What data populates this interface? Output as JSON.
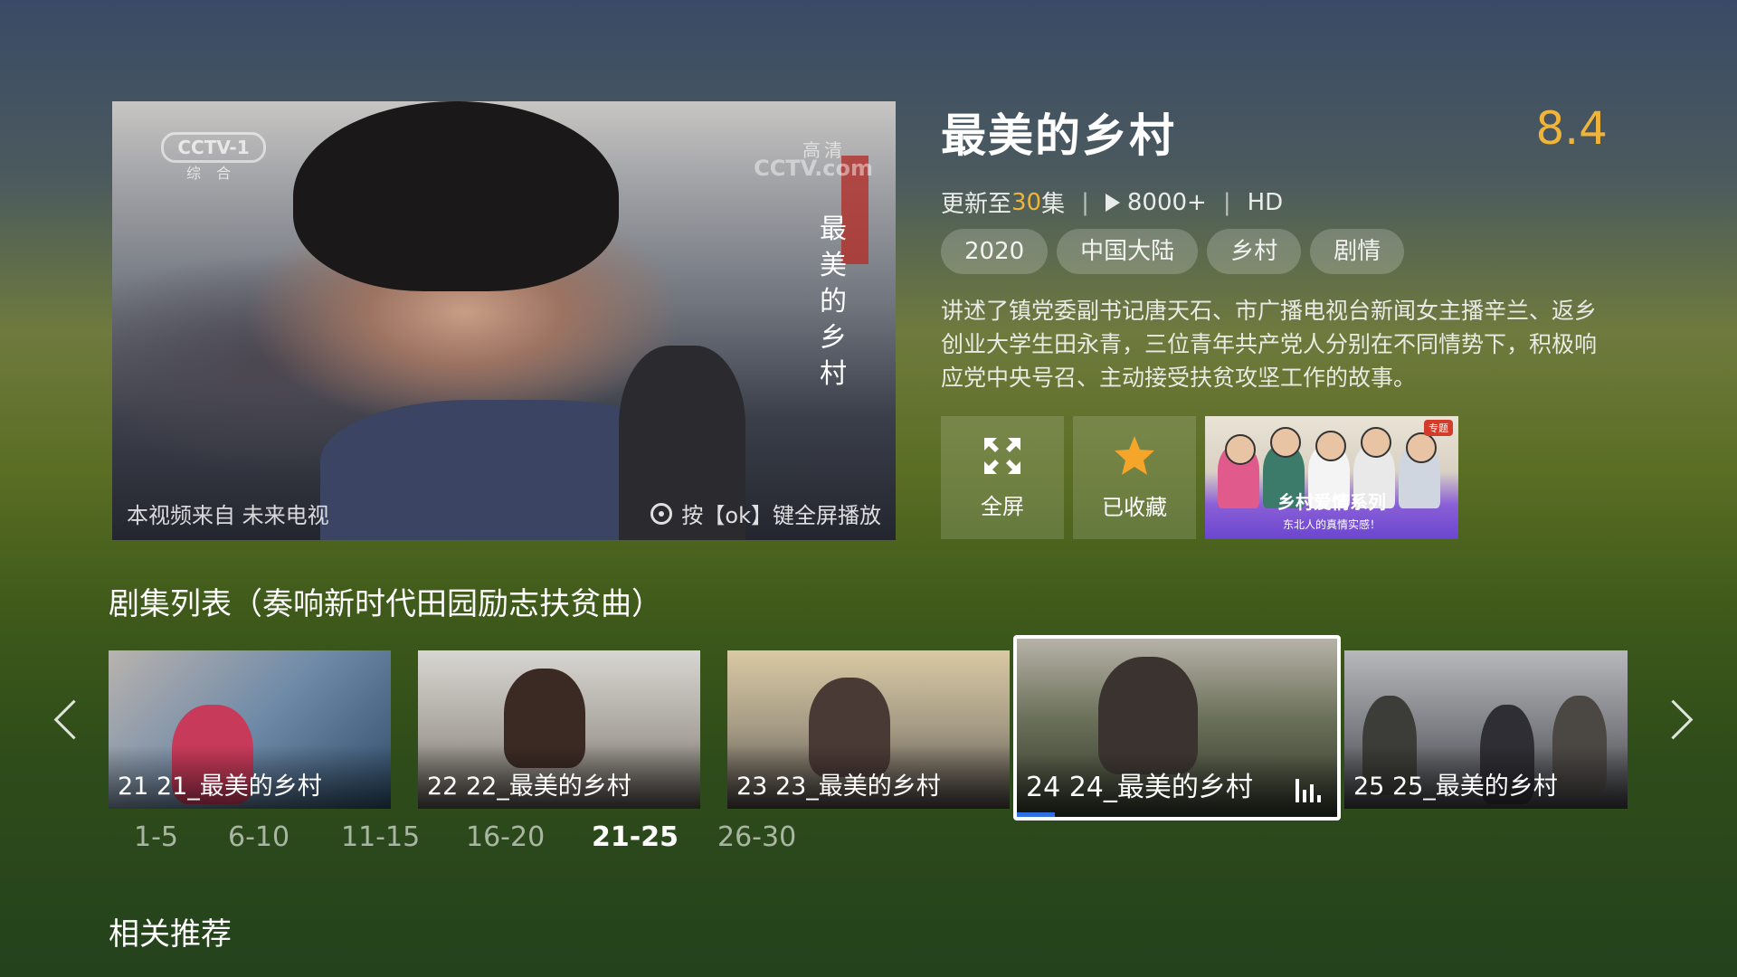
{
  "player": {
    "channel_logo": "CCTV-1",
    "channel_sub": "综 合",
    "hd_logo": "高清",
    "site_logo": "CCTV.com",
    "vertical_title": "最美的乡村",
    "source_text": "本视频来自 未来电视",
    "hint_text": "按【ok】键全屏播放"
  },
  "show": {
    "title": "最美的乡村",
    "score": "8.4",
    "update_prefix": "更新至",
    "update_count": "30",
    "update_suffix": "集",
    "plays": "8000+",
    "quality": "HD",
    "tags": [
      "2020",
      "中国大陆",
      "乡村",
      "剧情"
    ],
    "description": "讲述了镇党委副书记唐天石、市广播电视台新闻女主播辛兰、返乡创业大学生田永青，三位青年共产党人分别在不同情势下，积极响应党中央号召、主动接受扶贫攻坚工作的故事。"
  },
  "actions": {
    "fullscreen_label": "全屏",
    "favorite_label": "已收藏",
    "promo_badge": "专题",
    "promo_title": "乡村爱情系列",
    "promo_subtitle": "东北人的真情实感！"
  },
  "episodes": {
    "section_title": "剧集列表（奏响新时代田园励志扶贫曲）",
    "items": [
      {
        "label": "21 21_最美的乡村"
      },
      {
        "label": "22 22_最美的乡村"
      },
      {
        "label": "23 23_最美的乡村"
      },
      {
        "label": "24 24_最美的乡村",
        "playing": true,
        "progress": 0.12
      },
      {
        "label": "25 25_最美的乡村"
      }
    ],
    "ranges": [
      "1-5",
      "6-10",
      "11-15",
      "16-20",
      "21-25",
      "26-30"
    ],
    "selected_range": "21-25"
  },
  "related": {
    "title": "相关推荐"
  },
  "colors": {
    "accent": "#f0b43a",
    "progress": "#2f6fe6"
  },
  "icons": {
    "fullscreen": "fullscreen-icon",
    "favorite": "star-icon",
    "prev": "chevron-left-icon",
    "next": "chevron-right-icon",
    "playing": "equalizer-icon"
  }
}
